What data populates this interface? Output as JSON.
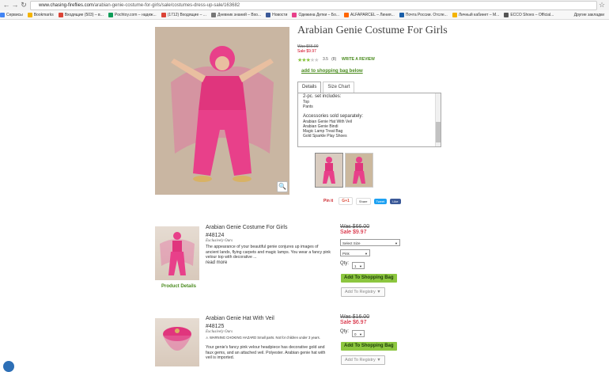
{
  "browser": {
    "url_host": "www.chasing-fireflies.com",
    "url_path": "/arabian-genie-costume-for-girls/sale/costumes-dress-up-sale/163682",
    "bookmarks": [
      "Сервисы",
      "Bookmarks",
      "Входящие (503) – в...",
      "Pochtoy.com – надеж...",
      "(1712) Входящие – ...",
      "Дневник знаний – Вхо...",
      "Новости",
      "Одежина Детки – Бо...",
      "ALFAPARCEL – Линия...",
      "Почта России. Отсле...",
      "Личный кабинет – М...",
      "ECCO Shoes – Official..."
    ],
    "other_bookmarks": "Другие закладки"
  },
  "product": {
    "title": "Arabian Genie Costume For Girls",
    "was": "Was $66.00",
    "sale": "Sale $9.97",
    "rating_value": 3.5,
    "rating_text": "3.5",
    "review_count": "(8)",
    "write_review": "WRITE A REVIEW",
    "add_link": "add to shopping bag below",
    "tabs": [
      "Details",
      "Size Chart"
    ],
    "details_lines": [
      "2-pc. set includes:",
      "Top",
      "Pants",
      "",
      "Accessories sold separately:",
      "Arabian Genie Hat With Veil",
      "Arabian Genie Bindi",
      "Magic Lamp Treat Bag",
      "Gold Sparkle Play Shoes"
    ],
    "share": {
      "pin": "Pin it",
      "gplus": "G+1",
      "share": "Share",
      "tweet": "Tweet",
      "like": "Like"
    }
  },
  "items": [
    {
      "name": "Arabian Genie Costume For Girls",
      "sku": "#48124",
      "exclusive": "Exclusively Ours",
      "description": "The appearance of your beautiful genie conjures up images of ancient lands, flying carpets and magic lamps. You wear a fancy pink velour top with decorative ...",
      "read_more": "read more",
      "details_link": "Product Details",
      "was": "Was $66.00",
      "sale": "Sale $9.97",
      "size_select": "Select Size",
      "color_select": "Pink",
      "qty_label": "Qty:",
      "qty": "1",
      "add_button": "Add To Shopping Bag",
      "registry_button": "Add To Registry"
    },
    {
      "name": "Arabian Genie Hat With Veil",
      "sku": "#48125",
      "exclusive": "Exclusively Ours",
      "warning": "WARNING CHOKING HAZARD Small parts. Not for children under 3 years.",
      "description": "Your genie's fancy pink velour headpiece has decorative gold and faux gems, and an attached veil. Polyester. Arabian genie hat with veil is imported.",
      "was": "Was $16.00",
      "sale": "Sale $6.97",
      "qty_label": "Qty:",
      "qty": "0",
      "add_button": "Add To Shopping Bag",
      "registry_button": "Add To Registry"
    }
  ],
  "colors": {
    "accent_green": "#8cc63f",
    "sale_red": "#d0021b",
    "link_green": "#4a8b1e",
    "costume_pink": "#e8408a"
  }
}
